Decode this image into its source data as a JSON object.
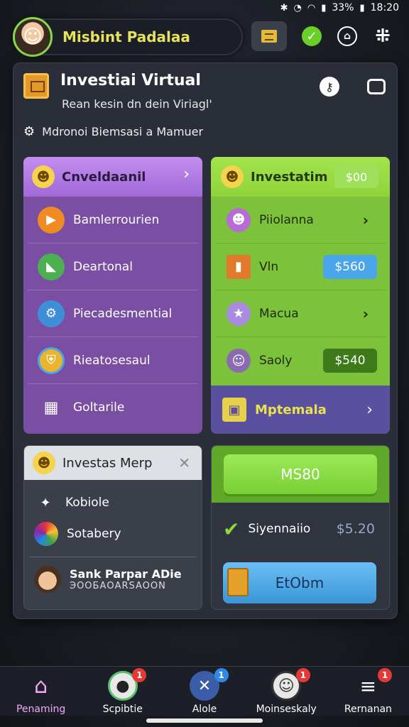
{
  "status": {
    "battery": "33%",
    "time": "18:20"
  },
  "profile": {
    "name": "Misbint Padalaa"
  },
  "panel": {
    "title": "Investiai Virtual",
    "subtitle": "Rean kesin dn dein Viriagl'",
    "section": "Mdronoi Biemsasi a Mamuer"
  },
  "card_purple": {
    "header": "Cnveldaanil",
    "items": [
      {
        "label": "Bamlerrourien"
      },
      {
        "label": "Deartonal"
      },
      {
        "label": "Piecadesmential"
      },
      {
        "label": "Rieatosesaul"
      },
      {
        "label": "Goltarile"
      }
    ]
  },
  "card_green": {
    "header": "Investatim",
    "header_badge": "$00",
    "items": [
      {
        "label": "Piiolanna"
      },
      {
        "label": "Vln",
        "price": "$560"
      },
      {
        "label": "Macua"
      },
      {
        "label": "Saoly",
        "price": "$540"
      }
    ],
    "footer": "Mptemala"
  },
  "card_gray": {
    "header": "Investas Merp",
    "items": [
      {
        "label": "Kobiole"
      },
      {
        "label": "Sotabery"
      }
    ],
    "user": {
      "name": "Sank Parpar ADie",
      "sub": "ЭООБАОАRSAOON"
    }
  },
  "card_dark": {
    "primary_button": "MS80",
    "row_label": "Siyennaiio",
    "row_value": "$5.20",
    "blue_button": "EtObm"
  },
  "tabs": [
    {
      "label": "Penaming",
      "active": true
    },
    {
      "label": "Scpibtie",
      "badge": "1"
    },
    {
      "label": "Alole",
      "badge": "1"
    },
    {
      "label": "Moinseskaly",
      "badge": "1"
    },
    {
      "label": "Rernanan",
      "badge": "1"
    }
  ]
}
